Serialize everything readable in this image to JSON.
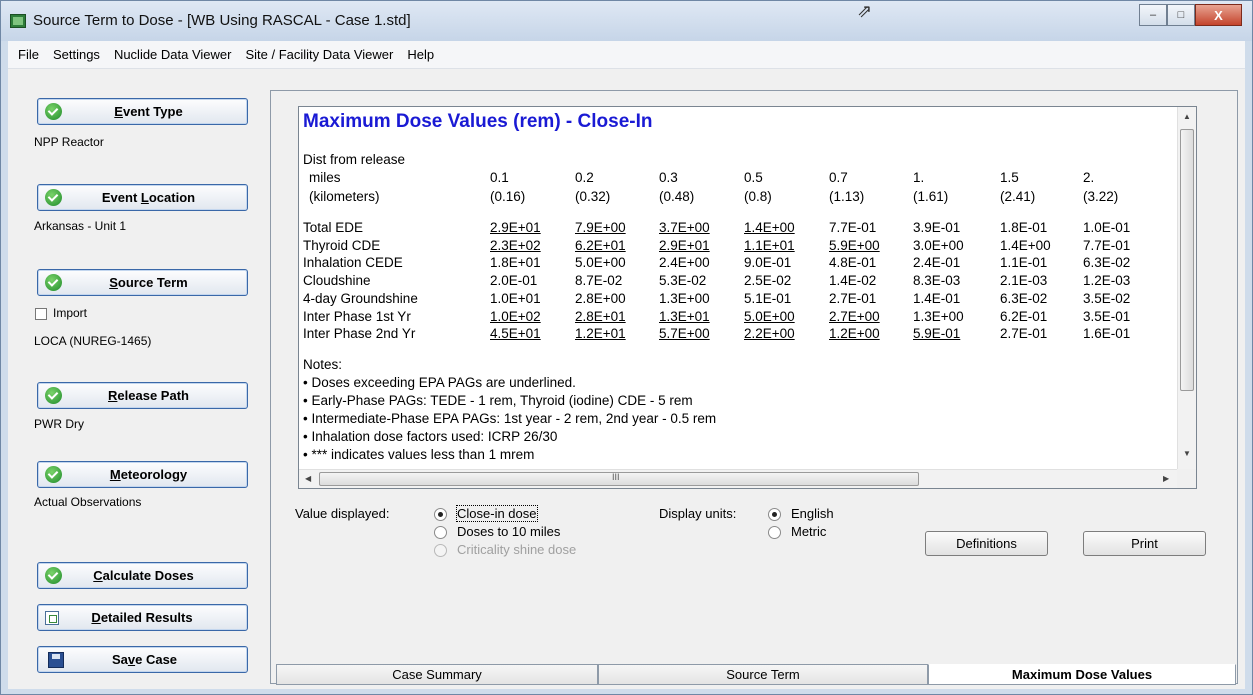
{
  "window": {
    "title": "Source Term to Dose - [WB Using RASCAL - Case 1.std]",
    "controls": {
      "minimize": "–",
      "maximize": "□",
      "close": "X"
    }
  },
  "menu": [
    "File",
    "Settings",
    "Nuclide Data Viewer",
    "Site / Facility Data Viewer",
    "Help"
  ],
  "sidebar": {
    "event_type": {
      "label_pre": "",
      "label_key": "E",
      "label_post": "vent Type",
      "value": "NPP Reactor"
    },
    "event_location": {
      "label_pre": "Event ",
      "label_key": "L",
      "label_post": "ocation",
      "value": "Arkansas - Unit 1"
    },
    "source_term": {
      "label_pre": "",
      "label_key": "S",
      "label_post": "ource Term",
      "import_label": "Import",
      "value": "LOCA (NUREG-1465)"
    },
    "release_path": {
      "label_pre": "",
      "label_key": "R",
      "label_post": "elease Path",
      "value": "PWR Dry"
    },
    "meteorology": {
      "label_pre": "",
      "label_key": "M",
      "label_post": "eteorology",
      "value": "Actual Observations"
    },
    "calculate": {
      "label_pre": "",
      "label_key": "C",
      "label_post": "alculate Doses"
    },
    "detailed": {
      "label_pre": "",
      "label_key": "D",
      "label_post": "etailed Results"
    },
    "save": {
      "label_pre": "Sa",
      "label_key": "v",
      "label_post": "e Case"
    }
  },
  "results": {
    "title": "Maximum Dose Values (rem) - Close-In",
    "dist_label": "Dist from release",
    "miles_label": "miles",
    "km_label": "(kilometers)",
    "miles": [
      "0.1",
      "0.2",
      "0.3",
      "0.5",
      "0.7",
      "1.",
      "1.5",
      "2."
    ],
    "km": [
      "(0.16)",
      "(0.32)",
      "(0.48)",
      "(0.8)",
      "(1.13)",
      "(1.61)",
      "(2.41)",
      "(3.22)"
    ],
    "rows": [
      {
        "label": "Total EDE",
        "values": [
          "2.9E+01",
          "7.9E+00",
          "3.7E+00",
          "1.4E+00",
          "7.7E-01",
          "3.9E-01",
          "1.8E-01",
          "1.0E-01"
        ],
        "underlined": [
          true,
          true,
          true,
          true,
          false,
          false,
          false,
          false
        ]
      },
      {
        "label": "Thyroid CDE",
        "values": [
          "2.3E+02",
          "6.2E+01",
          "2.9E+01",
          "1.1E+01",
          "5.9E+00",
          "3.0E+00",
          "1.4E+00",
          "7.7E-01"
        ],
        "underlined": [
          true,
          true,
          true,
          true,
          true,
          false,
          false,
          false
        ]
      },
      {
        "label": "Inhalation CEDE",
        "values": [
          "1.8E+01",
          "5.0E+00",
          "2.4E+00",
          "9.0E-01",
          "4.8E-01",
          "2.4E-01",
          "1.1E-01",
          "6.3E-02"
        ],
        "underlined": [
          false,
          false,
          false,
          false,
          false,
          false,
          false,
          false
        ]
      },
      {
        "label": "Cloudshine",
        "values": [
          "2.0E-01",
          "8.7E-02",
          "5.3E-02",
          "2.5E-02",
          "1.4E-02",
          "8.3E-03",
          "2.1E-03",
          "1.2E-03"
        ],
        "underlined": [
          false,
          false,
          false,
          false,
          false,
          false,
          false,
          false
        ]
      },
      {
        "label": "4-day Groundshine",
        "values": [
          "1.0E+01",
          "2.8E+00",
          "1.3E+00",
          "5.1E-01",
          "2.7E-01",
          "1.4E-01",
          "6.3E-02",
          "3.5E-02"
        ],
        "underlined": [
          false,
          false,
          false,
          false,
          false,
          false,
          false,
          false
        ]
      },
      {
        "label": "Inter Phase 1st Yr",
        "values": [
          "1.0E+02",
          "2.8E+01",
          "1.3E+01",
          "5.0E+00",
          "2.7E+00",
          "1.3E+00",
          "6.2E-01",
          "3.5E-01"
        ],
        "underlined": [
          true,
          true,
          true,
          true,
          true,
          false,
          false,
          false
        ]
      },
      {
        "label": "Inter Phase 2nd Yr",
        "values": [
          "4.5E+01",
          "1.2E+01",
          "5.7E+00",
          "2.2E+00",
          "1.2E+00",
          "5.9E-01",
          "2.7E-01",
          "1.6E-01"
        ],
        "underlined": [
          true,
          true,
          true,
          true,
          true,
          true,
          false,
          false
        ]
      }
    ],
    "notes_heading": "Notes:",
    "notes": [
      "• Doses exceeding EPA PAGs are underlined.",
      "• Early-Phase PAGs: TEDE - 1 rem, Thyroid (iodine) CDE - 5 rem",
      "• Intermediate-Phase EPA PAGs: 1st year - 2 rem, 2nd year - 0.5 rem",
      "• Inhalation dose factors used: ICRP 26/30",
      "• *** indicates values less than 1 mrem"
    ],
    "hscroll_grip": "III"
  },
  "options": {
    "value_displayed_label": "Value displayed:",
    "value_options": [
      "Close-in dose",
      "Doses to 10 miles",
      "Criticality shine dose"
    ],
    "value_selected": 0,
    "display_units_label": "Display units:",
    "unit_options": [
      "English",
      "Metric"
    ],
    "unit_selected": 0
  },
  "buttons": {
    "definitions": "Definitions",
    "print": "Print"
  },
  "tabs": [
    "Case Summary",
    "Source Term",
    "Maximum Dose Values"
  ],
  "active_tab": 2
}
